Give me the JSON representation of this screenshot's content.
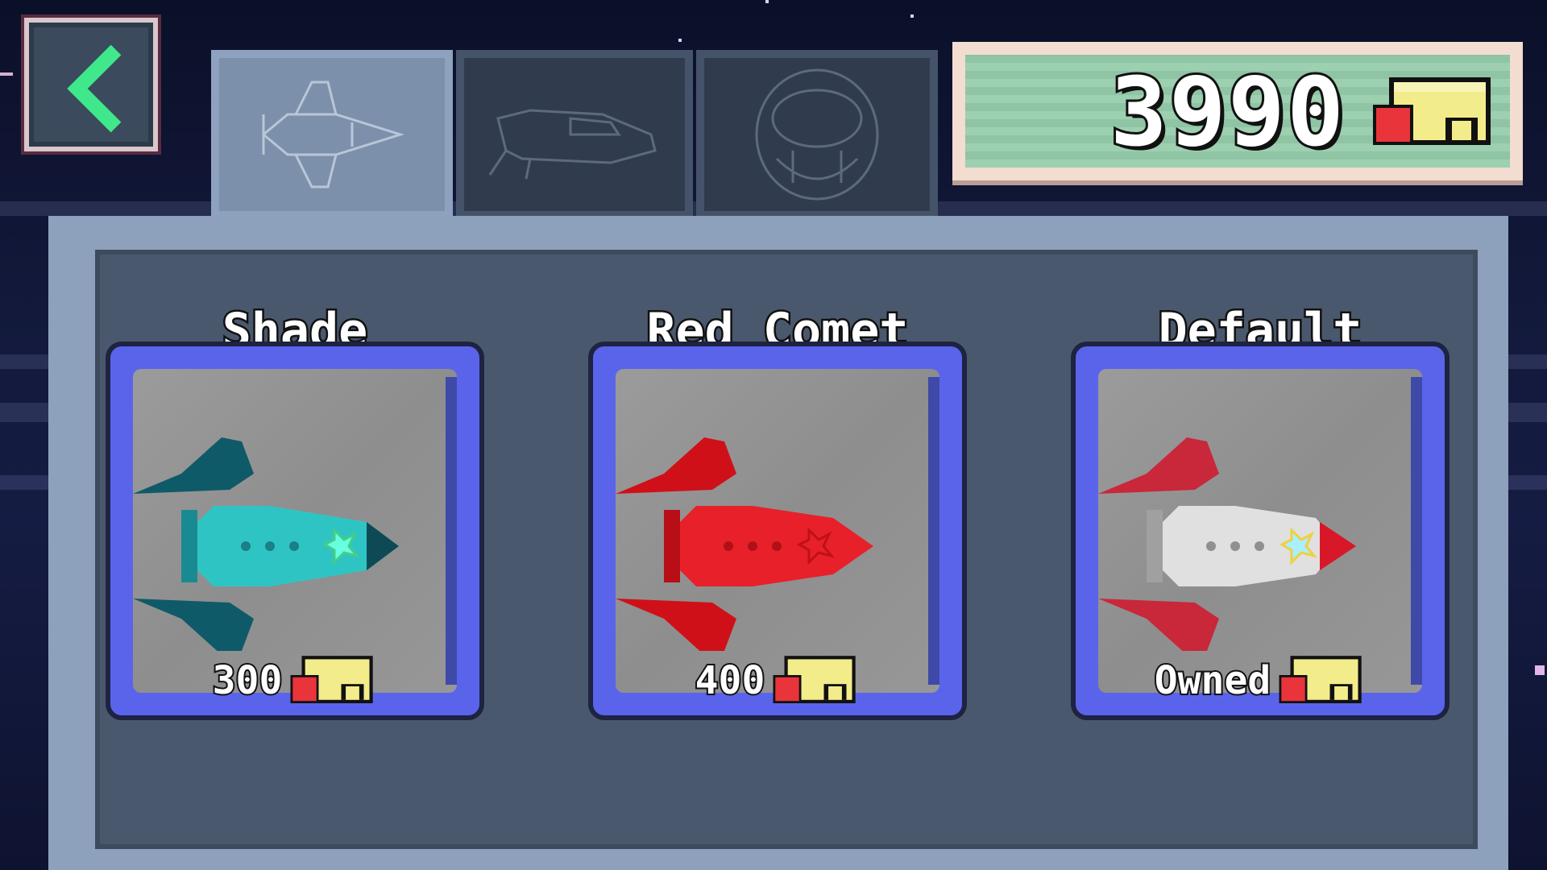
{
  "header": {
    "back_icon": "chevron-left-icon",
    "tabs": [
      {
        "icon": "ship-outline-icon",
        "active": true
      },
      {
        "icon": "hover-car-outline-icon",
        "active": false
      },
      {
        "icon": "helmet-outline-icon",
        "active": false
      }
    ]
  },
  "wallet": {
    "balance": "3990",
    "currency_icon": "coin-ticket-icon"
  },
  "shop": {
    "items": [
      {
        "name": "Shade",
        "price": "300",
        "ship_color": "#2fc4c4"
      },
      {
        "name": "Red Comet",
        "price": "400",
        "ship_color": "#e8202a"
      },
      {
        "name": "Default",
        "price": "Owned",
        "ship_color": "#e0e0e0"
      }
    ]
  },
  "colors": {
    "card_frame": "#5a64ea",
    "panel": "#4a586d",
    "counter_bg": "#8fc4a4"
  }
}
